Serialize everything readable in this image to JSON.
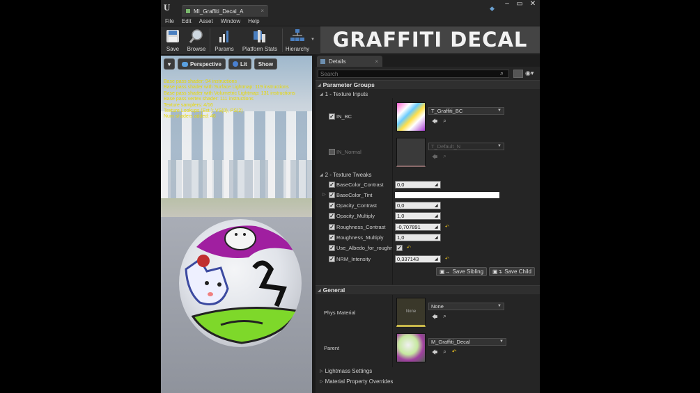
{
  "window": {
    "tab_title": "MI_Graffiti_Decal_A",
    "tab_close": "×",
    "win_minimize": "–",
    "win_restore": "▭",
    "win_close": "✕",
    "logo_glyph": "U"
  },
  "menu": [
    "File",
    "Edit",
    "Asset",
    "Window",
    "Help"
  ],
  "toolbar": {
    "buttons": [
      {
        "label": "Save",
        "icon": "save-icon"
      },
      {
        "label": "Browse",
        "icon": "browse-icon"
      },
      {
        "label": "Params",
        "icon": "params-icon"
      },
      {
        "label": "Platform Stats",
        "icon": "platform-stats-icon"
      },
      {
        "label": "Hierarchy",
        "icon": "hierarchy-icon"
      }
    ],
    "banner_text": "GRAFFITI DECAL"
  },
  "viewport": {
    "perspective": "Perspective",
    "lit": "Lit",
    "show": "Show",
    "stats": [
      "Base pass shader: 94 instructions",
      "Base pass shader with Surface Lightmap: 119 instructions",
      "Base pass shader with Volumetric Lightmap: 131 instructions",
      "Base pass vertex shader: 111 instructions",
      "Texture samplers: 4/16",
      "Texture Lookups (Est.): VS(0), PS(2)",
      "Num shaders added: 46"
    ]
  },
  "details": {
    "tab_label": "Details",
    "search_placeholder": "Search",
    "parameter_groups": "Parameter Groups",
    "texture_inputs": "1 - Texture Inputs",
    "in_bc": {
      "name": "IN_BC",
      "texture": "T_Graffiti_BC"
    },
    "in_normal": {
      "name": "IN_Normal",
      "texture": "T_Default_N"
    },
    "texture_tweaks": "2 - Texture Tweaks",
    "params": [
      {
        "name": "BaseColor_Contrast",
        "value": "0,0",
        "reset": false
      },
      {
        "name": "BaseColor_Tint",
        "value": "",
        "reset": false
      },
      {
        "name": "Opacity_Contrast",
        "value": "0,0",
        "reset": false
      },
      {
        "name": "Opacity_Multiply",
        "value": "1,0",
        "reset": false
      },
      {
        "name": "Roughness_Contrast",
        "value": "-0,707891",
        "reset": true
      },
      {
        "name": "Roughness_Multiply",
        "value": "1,0",
        "reset": false
      },
      {
        "name": "Use_Albedo_for_roughne",
        "value": "",
        "reset": true
      },
      {
        "name": "NRM_Intensity",
        "value": "0,337143",
        "reset": true
      }
    ],
    "save_sibling": "Save Sibling",
    "save_child": "Save Child",
    "general": "General",
    "phys_material": {
      "label": "Phys Material",
      "value": "None",
      "thumb_text": "None"
    },
    "parent": {
      "label": "Parent",
      "value": "M_Graffiti_Decal"
    },
    "lightmass": "Lightmass Settings",
    "material_overrides": "Material Property Overrides"
  },
  "colors": {
    "accent_yellow": "#e8d800",
    "panel_bg": "#252525",
    "reset_arrow": "#e8c020"
  }
}
